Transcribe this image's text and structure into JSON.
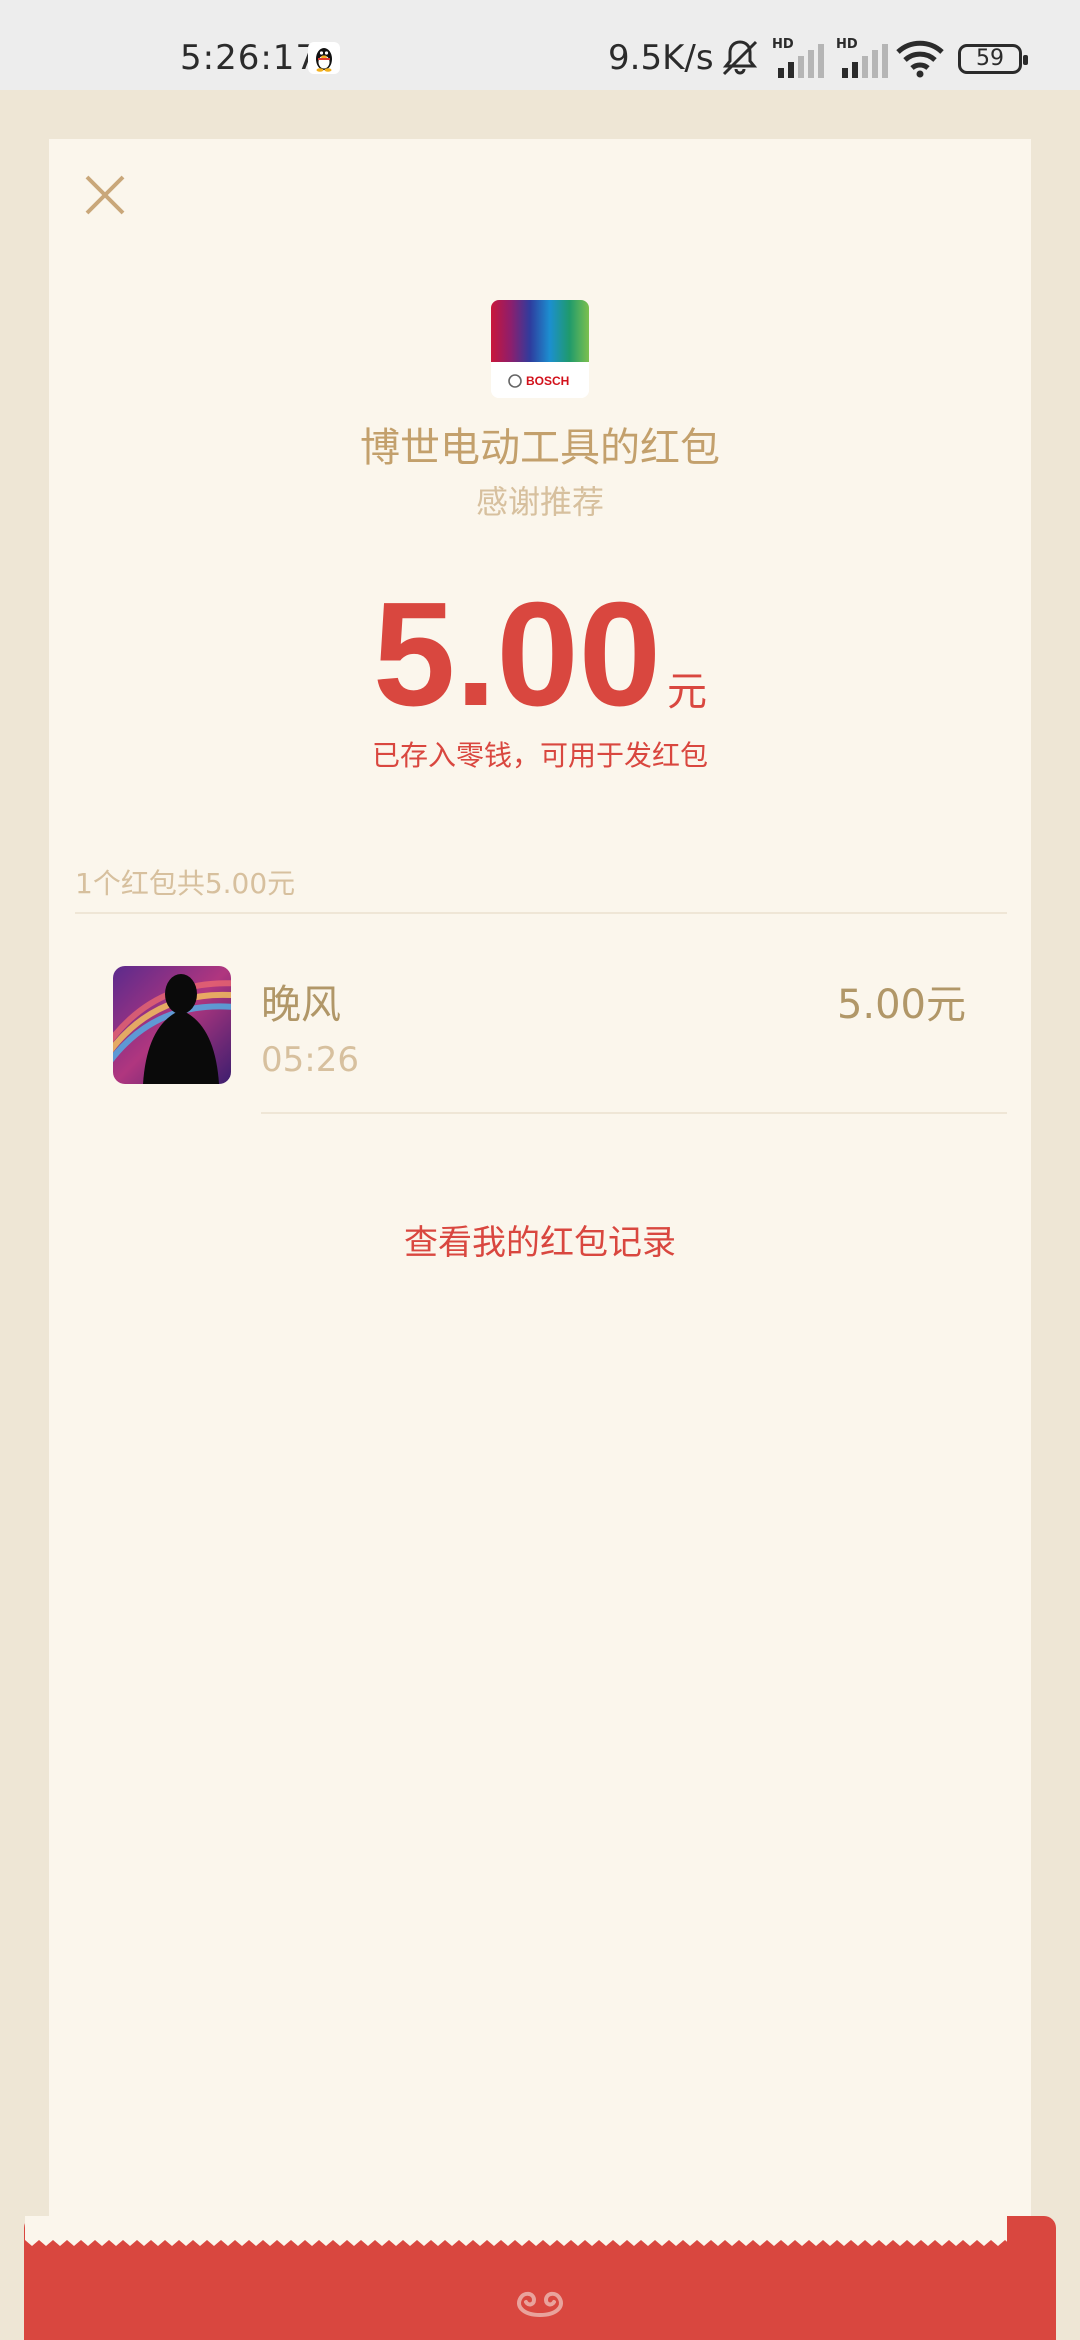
{
  "status_bar": {
    "time": "5:26:17",
    "network_speed": "9.5K/s",
    "signal_label_1": "HD",
    "signal_label_2": "HD",
    "battery": "59"
  },
  "packet": {
    "sender_title": "博世电动工具的红包",
    "subtitle": "感谢推荐",
    "amount": "5.00",
    "unit": "元",
    "note": "已存入零钱，可用于发红包",
    "summary": "1个红包共5.00元"
  },
  "recipients": [
    {
      "name": "晚风",
      "time": "05:26",
      "amount": "5.00元"
    }
  ],
  "links": {
    "records": "查看我的红包记录"
  },
  "brand": {
    "logo_text": "BOSCH"
  },
  "colors": {
    "background": "#EEE6D5",
    "card": "#FBF6EC",
    "accent_red": "#D9473F",
    "gold_text": "#C3A06C"
  }
}
